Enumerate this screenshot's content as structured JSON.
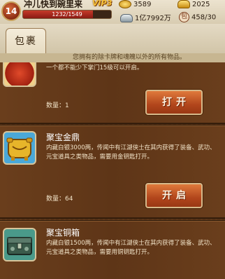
{
  "header": {
    "level": "14",
    "player_name": "冲儿快到碗里来",
    "vip": "VIP3",
    "exp_text": "1232/1549",
    "exp_fraction": 0.795,
    "silver": "3589",
    "gold": "2025",
    "money": "1亿7992万",
    "bag_count": "458/30"
  },
  "tabs": {
    "active_label": "包裹",
    "hint": "您拥有的除卡牌和魂魄以外的所有物品。"
  },
  "items": [
    {
      "name": "",
      "desc": "一个都不能少下掌门15级可以开启。",
      "qty_label": "数量：",
      "qty": "1",
      "button_label": "打开"
    },
    {
      "name": "聚宝金鼎",
      "desc": "内藏白银3000两，传闻中有江湖侠士在其内获得了装备、武功、元宝道具之类物品，需要用金钥匙打开。",
      "qty_label": "数量：",
      "qty": "64",
      "button_label": "开启"
    },
    {
      "name": "聚宝铜箱",
      "desc": "内藏白银1500两，传闻中有江湖侠士在其内获得了装备、武功、元宝道具之类物品，需要用铜钥匙打开。"
    }
  ]
}
